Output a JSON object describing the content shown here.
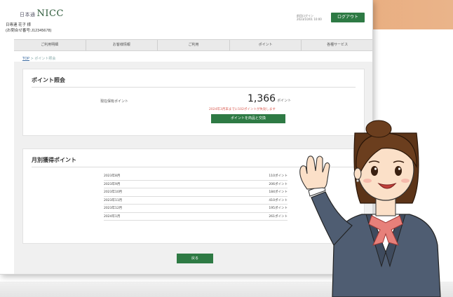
{
  "header": {
    "logo_prefix": "日本通",
    "logo_text": "NICC",
    "user_name": "日専連 花子 様",
    "customer_no": "(お問合せ番号:J12345678)",
    "login_note": "前回ログイン 2023/10/01 10:00",
    "logout_label": "ログアウト"
  },
  "nav": [
    "ご利用明細",
    "お客様情報",
    "ご利用",
    "ポイント",
    "各種サービス"
  ],
  "breadcrumb": {
    "home": "TOP",
    "sep": " > ",
    "current": "ポイント照会"
  },
  "points": {
    "title": "ポイント照会",
    "label": "現在保有ポイント",
    "value": "1,366",
    "unit": "ポイント",
    "note": "2024年3月末までに102ポイントが失効します",
    "exchange_button": "ポイントを商品と交換"
  },
  "expiry": {
    "title": "月別獲得ポイント",
    "rows": [
      {
        "month": "2023年8月",
        "points": "110ポイント"
      },
      {
        "month": "2023年9月",
        "points": "206ポイント"
      },
      {
        "month": "2023年10月",
        "points": "184ポイント"
      },
      {
        "month": "2023年11月",
        "points": "410ポイント"
      },
      {
        "month": "2023年12月",
        "points": "195ポイント"
      },
      {
        "month": "2024年1月",
        "points": "261ポイント"
      }
    ]
  },
  "back_button": "戻る",
  "colors": {
    "accent_green": "#2e7a44",
    "band_orange": "#e39a63",
    "warning_red": "#d8544a"
  }
}
